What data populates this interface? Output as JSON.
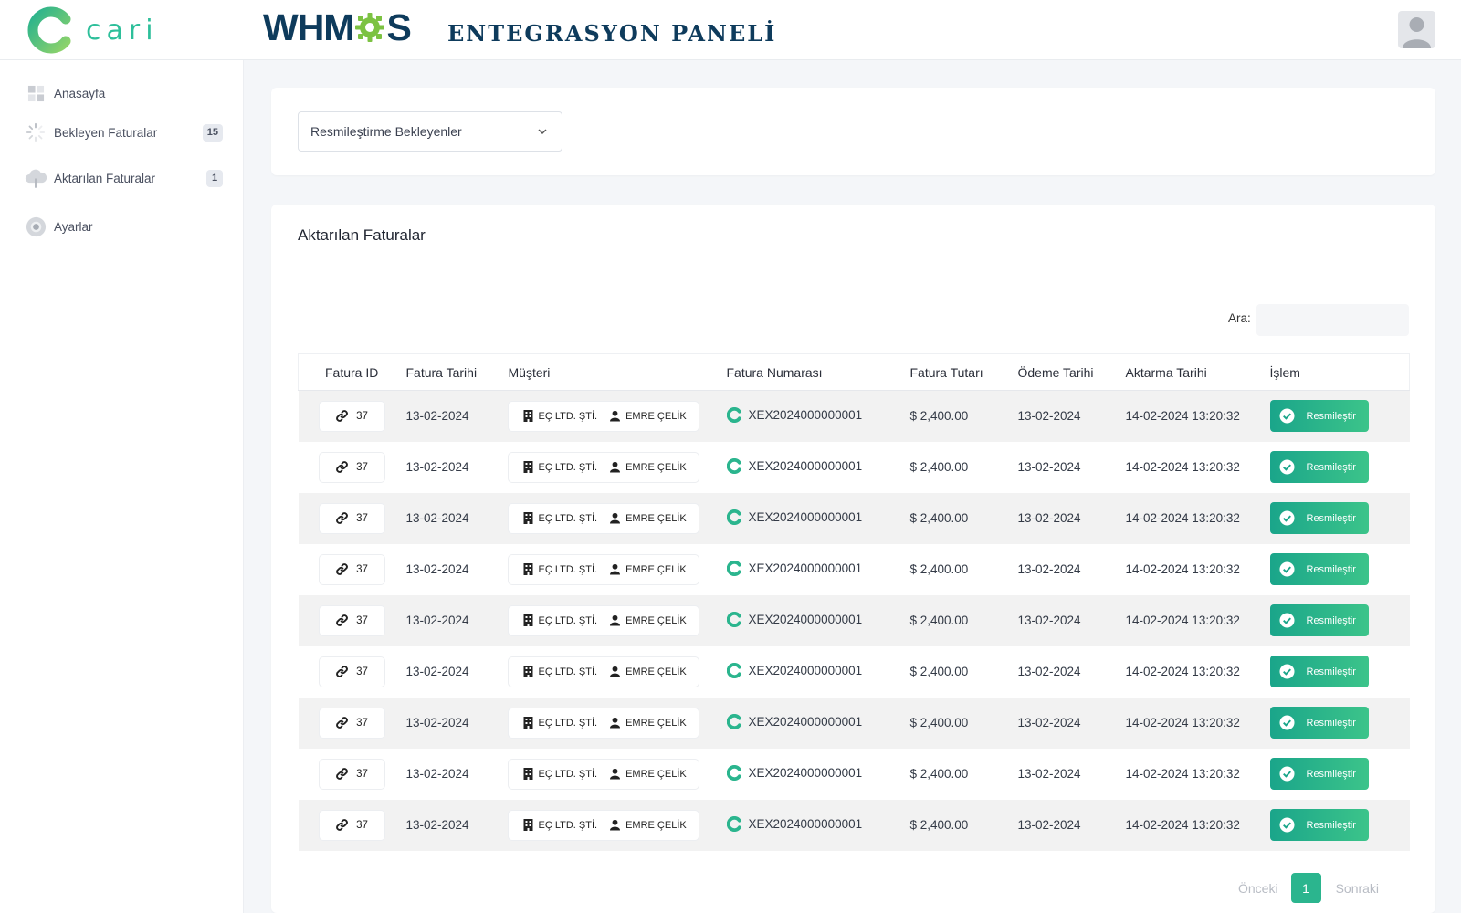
{
  "header": {
    "brand": "cari",
    "whmcs_logo": {
      "left": "WHM",
      "right": "S"
    },
    "title": "ENTEGRASYON PANELİ"
  },
  "sidebar": {
    "items": [
      {
        "label": "Anasayfa",
        "icon": "dashboard-icon",
        "badge": ""
      },
      {
        "label": "Bekleyen Faturalar",
        "icon": "spinner-icon",
        "badge": "15"
      },
      {
        "label": "Aktarılan Faturalar",
        "icon": "cloud-upload-icon",
        "badge": "1"
      },
      {
        "label": "Ayarlar",
        "icon": "gear-icon",
        "badge": ""
      }
    ]
  },
  "filter": {
    "selected": "Resmileştirme Bekleyenler"
  },
  "table_card": {
    "title": "Aktarılan Faturalar",
    "search_label": "Ara:",
    "search_value": "",
    "columns": [
      "Fatura ID",
      "Fatura Tarihi",
      "Müşteri",
      "Fatura Numarası",
      "Fatura Tutarı",
      "Ödeme Tarihi",
      "Aktarma Tarihi",
      "İşlem"
    ],
    "rows": [
      {
        "id": "37",
        "date": "13-02-2024",
        "company": "EÇ LTD. ŞTİ.",
        "person": "EMRE ÇELİK",
        "number": "XEX2024000000001",
        "amount": "$ 2,400.00",
        "pay_date": "13-02-2024",
        "transfer": "14-02-2024 13:20:32",
        "action": "Resmileştir"
      },
      {
        "id": "37",
        "date": "13-02-2024",
        "company": "EÇ LTD. ŞTİ.",
        "person": "EMRE ÇELİK",
        "number": "XEX2024000000001",
        "amount": "$ 2,400.00",
        "pay_date": "13-02-2024",
        "transfer": "14-02-2024 13:20:32",
        "action": "Resmileştir"
      },
      {
        "id": "37",
        "date": "13-02-2024",
        "company": "EÇ LTD. ŞTİ.",
        "person": "EMRE ÇELİK",
        "number": "XEX2024000000001",
        "amount": "$ 2,400.00",
        "pay_date": "13-02-2024",
        "transfer": "14-02-2024 13:20:32",
        "action": "Resmileştir"
      },
      {
        "id": "37",
        "date": "13-02-2024",
        "company": "EÇ LTD. ŞTİ.",
        "person": "EMRE ÇELİK",
        "number": "XEX2024000000001",
        "amount": "$ 2,400.00",
        "pay_date": "13-02-2024",
        "transfer": "14-02-2024 13:20:32",
        "action": "Resmileştir"
      },
      {
        "id": "37",
        "date": "13-02-2024",
        "company": "EÇ LTD. ŞTİ.",
        "person": "EMRE ÇELİK",
        "number": "XEX2024000000001",
        "amount": "$ 2,400.00",
        "pay_date": "13-02-2024",
        "transfer": "14-02-2024 13:20:32",
        "action": "Resmileştir"
      },
      {
        "id": "37",
        "date": "13-02-2024",
        "company": "EÇ LTD. ŞTİ.",
        "person": "EMRE ÇELİK",
        "number": "XEX2024000000001",
        "amount": "$ 2,400.00",
        "pay_date": "13-02-2024",
        "transfer": "14-02-2024 13:20:32",
        "action": "Resmileştir"
      },
      {
        "id": "37",
        "date": "13-02-2024",
        "company": "EÇ LTD. ŞTİ.",
        "person": "EMRE ÇELİK",
        "number": "XEX2024000000001",
        "amount": "$ 2,400.00",
        "pay_date": "13-02-2024",
        "transfer": "14-02-2024 13:20:32",
        "action": "Resmileştir"
      },
      {
        "id": "37",
        "date": "13-02-2024",
        "company": "EÇ LTD. ŞTİ.",
        "person": "EMRE ÇELİK",
        "number": "XEX2024000000001",
        "amount": "$ 2,400.00",
        "pay_date": "13-02-2024",
        "transfer": "14-02-2024 13:20:32",
        "action": "Resmileştir"
      },
      {
        "id": "37",
        "date": "13-02-2024",
        "company": "EÇ LTD. ŞTİ.",
        "person": "EMRE ÇELİK",
        "number": "XEX2024000000001",
        "amount": "$ 2,400.00",
        "pay_date": "13-02-2024",
        "transfer": "14-02-2024 13:20:32",
        "action": "Resmileştir"
      }
    ]
  },
  "pagination": {
    "prev": "Önceki",
    "current": "1",
    "next": "Sonraki"
  },
  "colors": {
    "accent": "#2bb58e",
    "brand_dark": "#0e3b5c",
    "gear_green": "#7cc242"
  }
}
